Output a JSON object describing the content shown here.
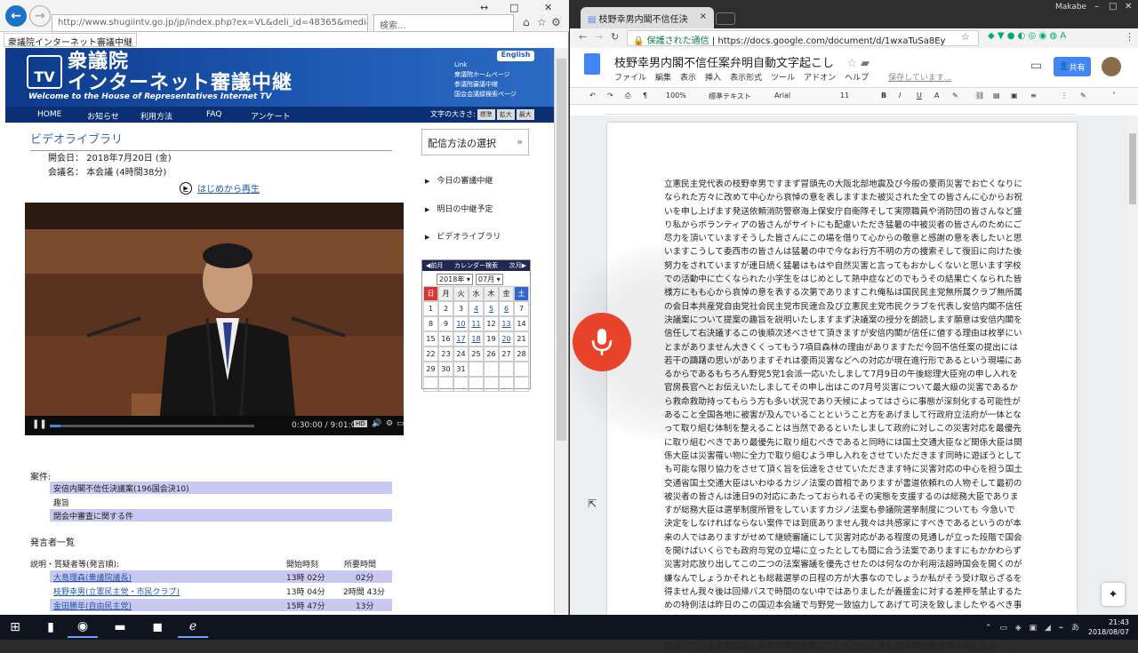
{
  "ie": {
    "url": "http://www.shugiintv.go.jp/jp/index.php?ex=VL&deli_id=48365&media_type=",
    "search_placeholder": "検索...",
    "tab_title": "衆議院インターネット審議中継",
    "site_title_line1": "衆議院",
    "site_title_line2": "インターネット審議中継",
    "site_subtitle": "Welcome to the House of Representatives Internet TV",
    "tv_logo": "TV",
    "english": "English",
    "link_title": "Link",
    "links": [
      "衆議院ホームページ",
      "参議院審議中継",
      "国会会議録検索ページ"
    ],
    "nav": [
      "HOME",
      "お知らせ",
      "利用方法",
      "FAQ",
      "アンケート"
    ],
    "font_size_label": "文字の大きさ:",
    "font_sizes": [
      "標準",
      "拡大",
      "最大"
    ],
    "video_library_title": "ビデオライブラリ",
    "date_label": "開会日：",
    "date_value": "2018年7月20日 (金)",
    "meeting_label": "会議名：",
    "meeting_value": "本会議 (4時間38分)",
    "play_from_start": "はじめから再生",
    "video_time": "0:30:00 / 9:01:08",
    "video_progress": 0.05,
    "hd_label": "HD",
    "haishin": "配信方法の選択",
    "side_links": [
      "今日の審議中継",
      "明日の中継予定",
      "ビデオライブラリ"
    ],
    "calendar": {
      "prev": "前月",
      "title": "カレンダー検索",
      "next": "次月",
      "year": "2018年",
      "month": "07月",
      "dow": [
        "日",
        "月",
        "火",
        "水",
        "木",
        "金",
        "土"
      ],
      "days": [
        "1",
        "2",
        "3",
        "4",
        "5",
        "6",
        "7",
        "8",
        "9",
        "10",
        "11",
        "12",
        "13",
        "14",
        "15",
        "16",
        "17",
        "18",
        "19",
        "20",
        "21",
        "22",
        "23",
        "24",
        "25",
        "26",
        "27",
        "28",
        "29",
        "30",
        "31",
        "",
        "",
        "",
        "",
        "",
        "",
        "",
        "",
        "",
        "",
        ""
      ],
      "linked_days": [
        "4",
        "5",
        "6",
        "10",
        "11",
        "13",
        "17",
        "18",
        "20"
      ]
    },
    "case_label": "案件:",
    "cases": [
      "安倍内閣不信任決議案(196国会決10)",
      "趣旨",
      "閉会中審査に関する件"
    ],
    "speakers_label": "発言者一覧",
    "sp_headers": [
      "説明・質疑者等(発言順):",
      "開始時刻",
      "所要時間"
    ],
    "speakers": [
      {
        "name": "大島理森(衆議院議長)",
        "start": "13時 02分",
        "dur": "02分"
      },
      {
        "name": "枝野幸男(立憲民主党・市民クラブ)",
        "start": "13時 04分",
        "dur": "2時間 43分"
      },
      {
        "name": "金田勝年(自由民主党)",
        "start": "15時 47分",
        "dur": "13分"
      }
    ]
  },
  "chrome": {
    "tab_title": "枝野幸男内閣不信任決",
    "user": "Makabe",
    "secure_label": "保護された通信",
    "url": "https://docs.google.com/document/d/1wxaTuSa8Ey",
    "doc_title": "枝野幸男内閣不信任案弁明自動文字起こし",
    "menu": [
      "ファイル",
      "編集",
      "表示",
      "挿入",
      "表示形式",
      "ツール",
      "アドオン",
      "ヘルプ"
    ],
    "saving": "保存しています...",
    "share": "共有",
    "zoom": "100%",
    "style": "標準テキスト",
    "font": "Arial",
    "font_size": "11",
    "body_text": "立憲民主党代表の枝野幸男ですまず冒頭先の大阪北部地震及び今般の豪雨災害でお亡くなりになられた方々に改めて中心から哀悼の意を表しますまた被災された全ての皆さんに心からお祝いを申し上げます発送依頼消防警察海上保安庁自衛隊そして実際職員や消防団の皆さんなど盛り私からボランティアの皆さんがサイトにも配慮いただき猛暑の中被災者の皆さんのためにご尽力を頂いていますそうした皆さんにこの場を借りて心からの敬意と感謝の意を表したいと思いますこうして委西市の皆さんは猛暑の中で今なお行方不明の方の捜索そして復旧に向けた後努力をされていますが連日続く猛暑はもはや自然災害と言ってもおかしくないと思います学校での活動中に亡くなられた小学生をはじめとして熱中症などのでもうその結果亡くなられた皆様方にもも心から哀悼の意を表する次第でありますこれ俺私は国民民主党無所属クラブ無所属の会日本共産党自由党社会民主党市民連合及び立憲民主党市民クラブを代表し安倍内閣不信任決議案について提案の趣旨を説明いたしますまず決議案の授分を朗読します願意は安倍内閣を信任して右決議するこの後順次述べさせて頂きますが安倍内閣が信任に値する理由は枚挙にいとまがありません大きくくってもう7項目森林の理由がありますただ今回不信任案の提出には若干の躊躇の思いがありますそれは豪雨災害などへの対応が現在進行形であるという現場にあるからであるもちろん野党5党1会派一応いたしまして7月9日の午後総理大臣宛の申し入れを官房長官へとお伝えいたしましてその申し出はこの7月号災害について最大級の災害であるから救命救助持ってもらう方も多い状況であり天候によってはさらに事態が深刻化する可能性があること全国各地に被害が及んでいることということ方をあげまして行政府立法府が一体となって取り組む体制を整えることは当然であるといたしまして政府に対しこの災害対応を最優先に取り組むべきであり最優先に取り組むべきであると同時には国土交通大臣など関係大臣は関係大臣は災害罹い物に全力で取り組むよう申し入れをさせていただきます同時に遊ぼうとしても可能な限り協力をさせて頂く旨を伝達をさせていただきます特に災害対応の中心を担う国土交通省国土交通大臣はいわゆるカジノ法案の首相でありますが書道依頼れの人物そして最初の被災者の皆さんは連日9の対応にあたっておられるその実態を支援するのは総務大臣でありますが総務大臣は選挙制度所管をしていますカジノ法案も参議院選挙制度についても 今急いで決定をしなければならない案件では到底ありません我々は共感家にすべきであるというのが本来の人ではありますがせめて継続審議にして災害対応がある程度の見通しが立った段階で国会を開けばいくらでも政府与党の立場に立ったとしても間に合う法案でありますにもかかわらず災害対応放り出してこの二つの法案審議を優先させたのは何なのか利用法超時国会を開くのが嫌なんでしょうかそれとも総裁選挙の日程の方が大事なのでしょうか私がそう受け取らざるを得ません我々後は回帰バスで時間のない中ではありましたが義援金に対する差押を禁止するための特例法は昨日のこの国辺本会議で与野党一致協力してあげて可決を致しましたやるべき事は急いでやることのことに協力は出来ているところがありますオーテモリの選挙制度をやるならともかくとは今年の3月に被災者生活再建支援法と災害弔慰金支給法の一部改正案を国会に転送していますが国会に掲載の裏側を聞いていたからこうした法案の審議のは弱そうだ：...:::"
  },
  "taskbar": {
    "time": "21:43",
    "date": "2018/08/07",
    "ime": "あ"
  }
}
